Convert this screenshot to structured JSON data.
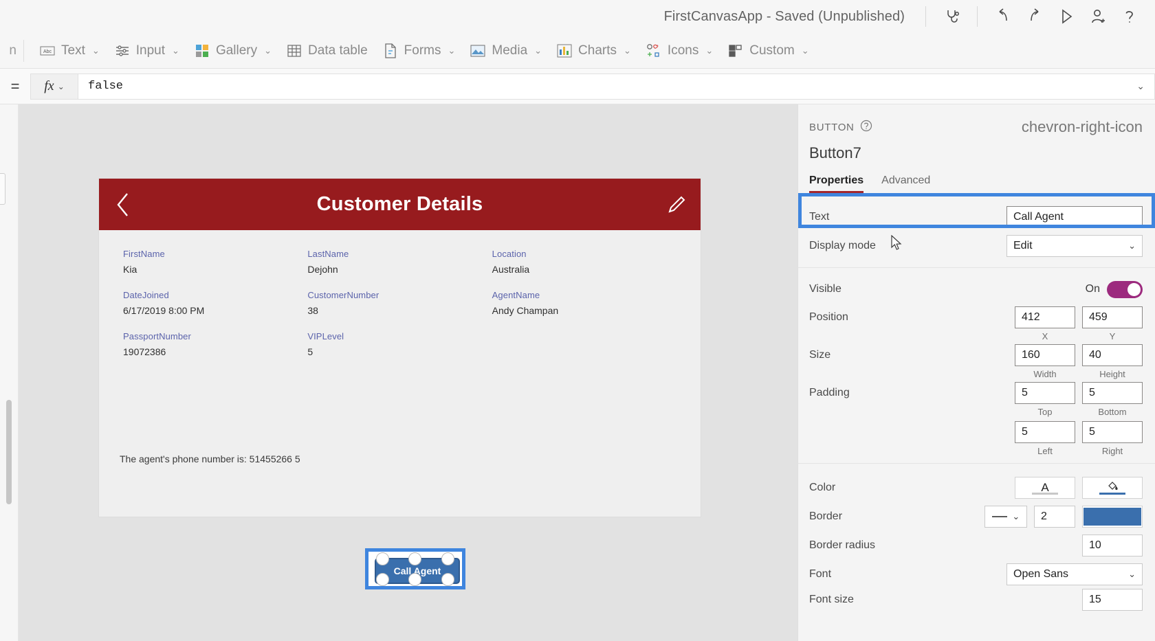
{
  "topbar": {
    "app_title": "FirstCanvasApp - Saved (Unpublished)",
    "icons": [
      {
        "name": "app-checker-icon",
        "label": "App checker"
      },
      {
        "name": "undo-icon",
        "label": "Undo"
      },
      {
        "name": "redo-icon",
        "label": "Redo"
      },
      {
        "name": "preview-play-icon",
        "label": "Preview the app"
      },
      {
        "name": "share-user-icon",
        "label": "Share"
      },
      {
        "name": "help-question-icon",
        "label": "Help"
      }
    ]
  },
  "ribbon": {
    "edge_label": "n",
    "items": [
      {
        "label": "Text",
        "icon": "abc-text-icon",
        "caret": "⌄"
      },
      {
        "label": "Input",
        "icon": "sliders-input-icon",
        "caret": "⌄"
      },
      {
        "label": "Gallery",
        "icon": "gallery-grid-icon",
        "caret": "⌄"
      },
      {
        "label": "Data table",
        "icon": "data-table-icon",
        "caret": ""
      },
      {
        "label": "Forms",
        "icon": "forms-document-icon",
        "caret": "⌄"
      },
      {
        "label": "Media",
        "icon": "media-image-icon",
        "caret": "⌄"
      },
      {
        "label": "Charts",
        "icon": "charts-bar-icon",
        "caret": "⌄"
      },
      {
        "label": "Icons",
        "icon": "icons-shapes-icon",
        "caret": "⌄"
      },
      {
        "label": "Custom",
        "icon": "custom-blocks-icon",
        "caret": "⌄"
      }
    ]
  },
  "formula_bar": {
    "equals": "=",
    "fx_label": "fx",
    "fx_caret": "⌄",
    "value": "false",
    "expand_caret": "⌄"
  },
  "canvas": {
    "header": {
      "title": "Customer Details",
      "back_icon": "back-chevron-icon",
      "edit_icon": "pencil-edit-icon",
      "background": "#971b1e"
    },
    "fields": [
      [
        {
          "label": "FirstName",
          "value": "Kia"
        },
        {
          "label": "LastName",
          "value": "Dejohn"
        },
        {
          "label": "Location",
          "value": "Australia"
        }
      ],
      [
        {
          "label": "DateJoined",
          "value": "6/17/2019 8:00 PM"
        },
        {
          "label": "CustomerNumber",
          "value": "38"
        },
        {
          "label": "AgentName",
          "value": "Andy Champan"
        }
      ],
      [
        {
          "label": "PassportNumber",
          "value": "19072386"
        },
        {
          "label": "VIPLevel",
          "value": "5"
        },
        {
          "label": "",
          "value": ""
        }
      ]
    ],
    "agent_phone_text": "The agent's phone number is: 51455266 5",
    "selected_button_label": "Call Agent"
  },
  "panel": {
    "kicker": "BUTTON",
    "help_icon": "help-circle-icon",
    "control_name": "Button7",
    "collapse_icon": "chevron-right-icon",
    "tabs": [
      {
        "label": "Properties",
        "active": true
      },
      {
        "label": "Advanced",
        "active": false
      }
    ],
    "text_row": {
      "label": "Text",
      "value": "Call Agent"
    },
    "display_mode_row": {
      "label": "Display mode",
      "value": "Edit",
      "caret": "⌄"
    },
    "visible_row": {
      "label": "Visible",
      "state": "On"
    },
    "position_row": {
      "label": "Position",
      "x": {
        "value": "412",
        "sub": "X"
      },
      "y": {
        "value": "459",
        "sub": "Y"
      }
    },
    "size_row": {
      "label": "Size",
      "width": {
        "value": "160",
        "sub": "Width"
      },
      "height": {
        "value": "40",
        "sub": "Height"
      }
    },
    "padding_row": {
      "label": "Padding",
      "top": {
        "value": "5",
        "sub": "Top"
      },
      "bottom": {
        "value": "5",
        "sub": "Bottom"
      },
      "left": {
        "value": "5",
        "sub": "Left"
      },
      "right": {
        "value": "5",
        "sub": "Right"
      }
    },
    "color_row": {
      "label": "Color",
      "text_color_glyph": "A",
      "fill_icon": "paint-bucket-icon"
    },
    "border_row": {
      "label": "Border",
      "style_caret": "⌄",
      "thickness": "2",
      "color_hex": "#3a6fad"
    },
    "border_radius_row": {
      "label": "Border radius",
      "value": "10"
    },
    "font_row": {
      "label": "Font",
      "value": "Open Sans",
      "caret": "⌄"
    },
    "font_size_row": {
      "label": "Font size",
      "value": "15"
    }
  },
  "colors": {
    "accent_red": "#a4262c",
    "selection_blue": "#3f85de",
    "toggle_on": "#9c2a7e",
    "button_fill": "#3a6fad",
    "label_blue": "#5b63ab"
  }
}
